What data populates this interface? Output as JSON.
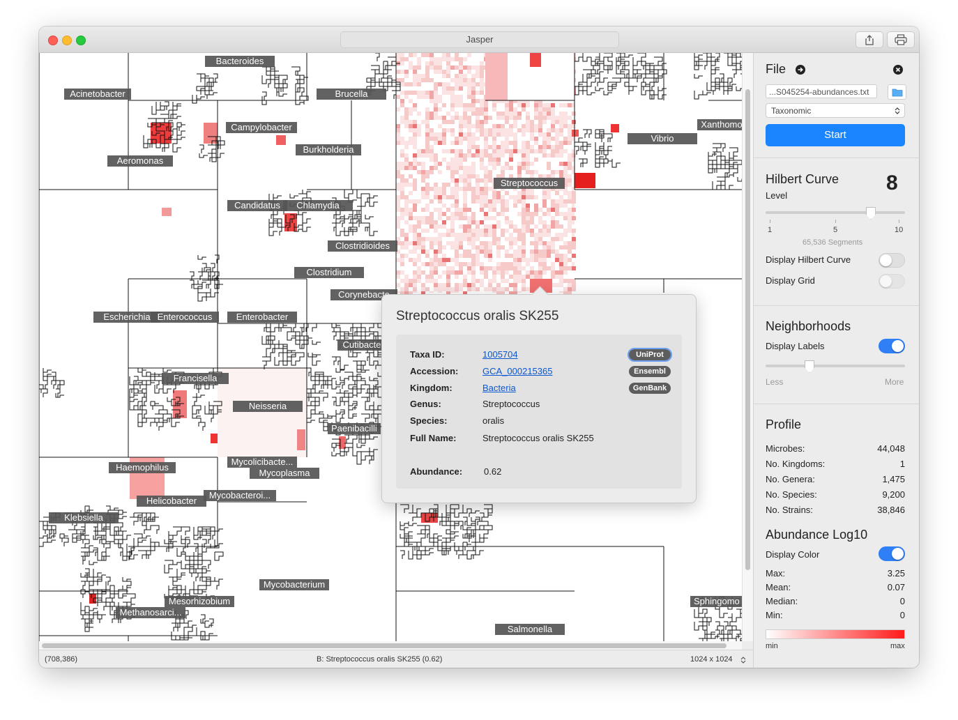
{
  "window": {
    "title": "Jasper"
  },
  "map": {
    "labels": [
      {
        "name": "acinetobacter",
        "text": "Acinetobacter"
      },
      {
        "name": "bacteroides",
        "text": "Bacteroides"
      },
      {
        "name": "brucella",
        "text": "Brucella"
      },
      {
        "name": "campylobacter",
        "text": "Campylobacter"
      },
      {
        "name": "burkholderia",
        "text": "Burkholderia"
      },
      {
        "name": "aeromonas",
        "text": "Aeromonas"
      },
      {
        "name": "vibrio",
        "text": "Vibrio"
      },
      {
        "name": "xanthomonas",
        "text": "Xanthomo"
      },
      {
        "name": "streptococcus",
        "text": "Streptococcus"
      },
      {
        "name": "candidatus",
        "text": "Candidatus"
      },
      {
        "name": "chlamydia",
        "text": "Chlamydia"
      },
      {
        "name": "clostridioides",
        "text": "Clostridioides"
      },
      {
        "name": "clostridium",
        "text": "Clostridium"
      },
      {
        "name": "corynebacterium",
        "text": "Corynebacte"
      },
      {
        "name": "escherichia",
        "text": "Escherichia"
      },
      {
        "name": "enterococcus",
        "text": "Enterococcus"
      },
      {
        "name": "enterobacter",
        "text": "Enterobacter"
      },
      {
        "name": "cutibacterium",
        "text": "Cutibacte"
      },
      {
        "name": "francisella",
        "text": "Francisella"
      },
      {
        "name": "neisseria",
        "text": "Neisseria"
      },
      {
        "name": "paenibacillus",
        "text": "Paenibacilli"
      },
      {
        "name": "haemophilus",
        "text": "Haemophilus"
      },
      {
        "name": "mycolicibacterium",
        "text": "Mycolicibacte..."
      },
      {
        "name": "mycoplasma",
        "text": "Mycoplasma"
      },
      {
        "name": "helicobacter",
        "text": "Helicobacter"
      },
      {
        "name": "mycobacteroides",
        "text": "Mycobacteroi..."
      },
      {
        "name": "klebsiella",
        "text": "Klebsiella"
      },
      {
        "name": "mycobacterium",
        "text": "Mycobacterium"
      },
      {
        "name": "mesorhizobium",
        "text": "Mesorhizobium"
      },
      {
        "name": "methanosarcina",
        "text": "Methanosarci..."
      },
      {
        "name": "sphingomonas",
        "text": "Sphingomo"
      },
      {
        "name": "salmonella",
        "text": "Salmonella"
      }
    ]
  },
  "popover": {
    "title": "Streptococcus oralis SK255",
    "fields": {
      "taxa_id_label": "Taxa ID:",
      "taxa_id": "1005704",
      "accession_label": "Accession:",
      "accession": "GCA_000215365",
      "kingdom_label": "Kingdom:",
      "kingdom": "Bacteria",
      "genus_label": "Genus:",
      "genus": "Streptococcus",
      "species_label": "Species:",
      "species": "oralis",
      "full_name_label": "Full Name:",
      "full_name": "Streptococcus oralis SK255",
      "abundance_label": "Abundance:",
      "abundance": "0.62"
    },
    "buttons": {
      "uniprot": "UniProt",
      "ensembl": "Ensembl",
      "genbank": "GenBank"
    }
  },
  "status": {
    "coords": "(708,386)",
    "selection": "B:  Streptococcus oralis SK255 (0.62)",
    "size": "1024 x 1024"
  },
  "sidebar": {
    "file": {
      "heading": "File",
      "path": "...S045254-abundances.txt",
      "mode": "Taxonomic",
      "start": "Start"
    },
    "hilbert": {
      "heading": "Hilbert Curve",
      "level_label": "Level",
      "level_value": "8",
      "level": 8,
      "level_min": 1,
      "level_max": 10,
      "tick_1": "1",
      "tick_5": "5",
      "tick_10": "10",
      "segments": "65,536 Segments",
      "display_curve": "Display Hilbert Curve",
      "display_curve_on": false,
      "display_grid": "Display Grid",
      "display_grid_on": false
    },
    "neighborhoods": {
      "heading": "Neighborhoods",
      "display_labels": "Display Labels",
      "display_labels_on": true,
      "less": "Less",
      "more": "More",
      "density": 0.31
    },
    "profile": {
      "heading": "Profile",
      "rows": [
        {
          "label": "Microbes:",
          "value": "44,048"
        },
        {
          "label": "No. Kingdoms:",
          "value": "1"
        },
        {
          "label": "No. Genera:",
          "value": "1,475"
        },
        {
          "label": "No. Species:",
          "value": "9,200"
        },
        {
          "label": "No. Strains:",
          "value": "38,846"
        }
      ]
    },
    "abundance": {
      "heading": "Abundance Log10",
      "display_color": "Display Color",
      "display_color_on": true,
      "rows": [
        {
          "label": "Max:",
          "value": "3.25"
        },
        {
          "label": "Mean:",
          "value": "0.07"
        },
        {
          "label": "Median:",
          "value": "0"
        },
        {
          "label": "Min:",
          "value": "0"
        }
      ],
      "min_label": "min",
      "max_label": "max",
      "gradient_colors": [
        "#ffffff",
        "#ff1a1a"
      ]
    }
  }
}
